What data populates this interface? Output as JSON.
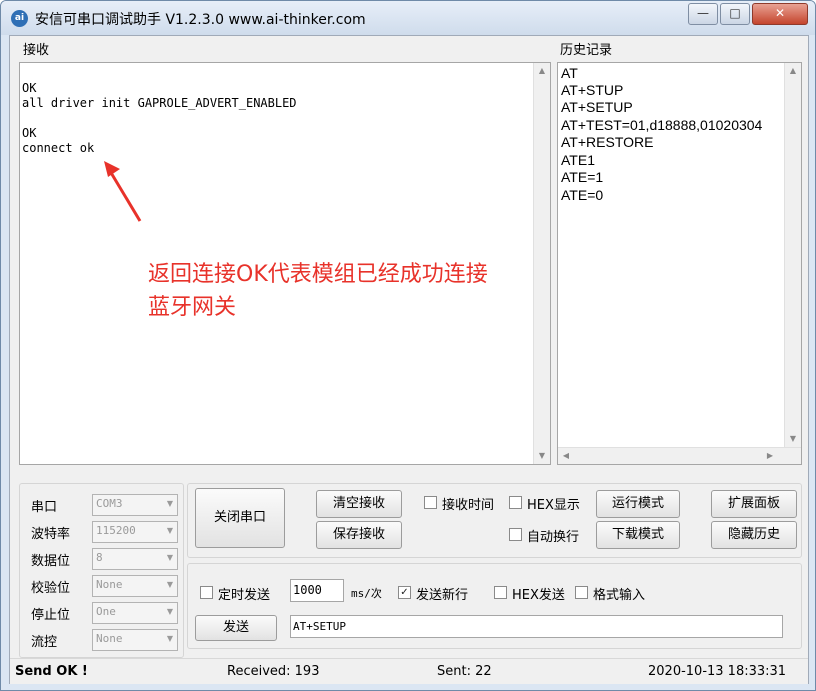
{
  "window": {
    "title": "安信可串口调试助手 V1.2.3.0    www.ai-thinker.com",
    "icon_text": "ai",
    "minimize_glyph": "—",
    "maximize_glyph": "□",
    "close_glyph": "✕"
  },
  "receive": {
    "label": "接收",
    "lines": [
      "OK",
      "all driver init GAPROLE_ADVERT_ENABLED",
      "",
      "OK",
      "connect ok"
    ],
    "annotation_line1": "返回连接OK代表模组已经成功连接",
    "annotation_line2": "蓝牙网关",
    "annotation_color": "#e8322a"
  },
  "history": {
    "label": "历史记录",
    "items": [
      "AT",
      "AT+STUP",
      "AT+SETUP",
      "AT+TEST=01,d18888,01020304",
      "AT+RESTORE",
      "ATE1",
      "ATE=1",
      "ATE=0"
    ]
  },
  "serial": {
    "port_label": "串口",
    "port_value": "COM3",
    "baud_label": "波特率",
    "baud_value": "115200",
    "databits_label": "数据位",
    "databits_value": "8",
    "parity_label": "校验位",
    "parity_value": "None",
    "stopbits_label": "停止位",
    "stopbits_value": "One",
    "flow_label": "流控",
    "flow_value": "None"
  },
  "controls": {
    "close_port": "关闭串口",
    "clear_receive": "清空接收",
    "save_receive": "保存接收",
    "recv_time": "接收时间",
    "hex_display": "HEX显示",
    "run_mode": "运行模式",
    "expand_panel": "扩展面板",
    "auto_newline": "自动换行",
    "download_mode": "下载模式",
    "hide_history": "隐藏历史"
  },
  "send": {
    "timed_send": "定时发送",
    "interval_value": "1000",
    "interval_unit": "ms/次",
    "send_newline": "发送新行",
    "hex_send": "HEX发送",
    "format_input": "格式输入",
    "send_button": "发送",
    "input_value": "AT+SETUP",
    "check_glyph": "✓"
  },
  "status": {
    "message": "Send OK !",
    "received": "Received: 193",
    "sent": "Sent: 22",
    "datetime": "2020-10-13 18:33:31"
  }
}
